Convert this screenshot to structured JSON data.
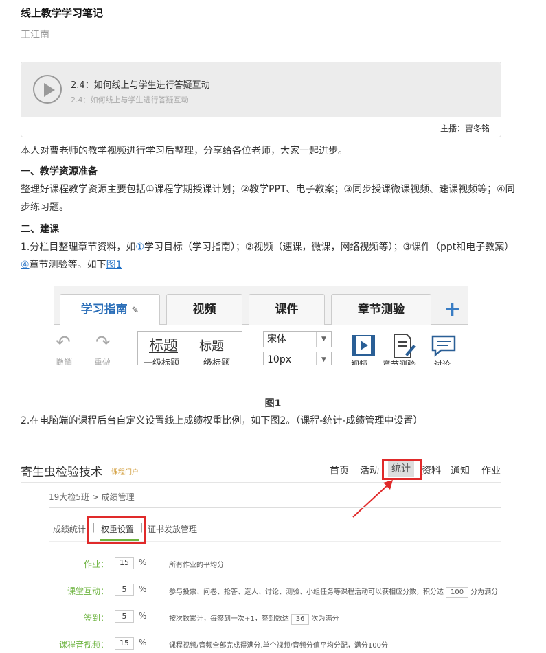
{
  "article": {
    "title": "线上教学学习笔记",
    "author": "王江南"
  },
  "audio": {
    "title": "2.4：如何线上与学生进行答疑互动",
    "subtitle": "2.4：如何线上与学生进行答疑互动",
    "host": "主播：曹冬铭"
  },
  "body": {
    "intro": "本人对曹老师的教学视频进行学习后整理，分享给各位老师，大家一起进步。",
    "h1": "一、教学资源准备",
    "p1": "整理好课程教学资源主要包括①课程学期授课计划；②教学PPT、电子教案；③同步授课微课视频、速课视频等；④同步练习题。",
    "h2": "二、建课",
    "p2_a": "1.分栏目整理章节资料，如",
    "p2_link1": "①",
    "p2_b": "学习目标（学习指南）；②视频（速课，微课，网络视频等）；③课件（ppt和电子教案）",
    "p2_link2": "④",
    "p2_c": "章节测验等。如下",
    "p2_link3": "图1",
    "fig1_caption": "图1",
    "p3": "2.在电脑端的课程后台自定义设置线上成绩权重比例，如下图2。（课程-统计-成绩管理中设置）"
  },
  "fig1": {
    "tabs": [
      "学习指南",
      "视频",
      "课件",
      "章节测验"
    ],
    "plus": "+",
    "undo_label": "撤销",
    "redo_label": "重做",
    "style_title_big": "标题",
    "style_title_med": "标题",
    "style_sub1": "一级标题",
    "style_sub2": "二级标题",
    "font_select": "宋体",
    "size_select": "10px",
    "insert_video": "视频",
    "insert_quiz": "章节测验",
    "insert_discuss": "讨论"
  },
  "fig2": {
    "course_name": "寄生虫检验技术",
    "course_sub": "课程门户",
    "nav": [
      "首页",
      "活动",
      "统计",
      "资料",
      "通知",
      "作业"
    ],
    "breadcrumb": "19大检5班 > 成绩管理",
    "subtabs": [
      "成绩统计",
      "权重设置",
      "证书发放管理"
    ],
    "rows": [
      {
        "label": "作业：",
        "value": "15",
        "unit": "%",
        "desc": "所有作业的平均分"
      },
      {
        "label": "课堂互动：",
        "value": "5",
        "unit": "%",
        "desc": "参与投票、问卷、抢答、选人、讨论、测验、小组任务等课程活动可以获相应分数，积分达",
        "extra_value": "100",
        "extra_text": "分为满分"
      },
      {
        "label": "签到：",
        "value": "5",
        "unit": "%",
        "desc": "按次数累计，每签到一次+1，签到数达",
        "extra_value": "36",
        "extra_text": "次为满分"
      },
      {
        "label": "课程音视频：",
        "value": "15",
        "unit": "%",
        "desc": "课程视频/音频全部完成得满分,单个视频/音频分值平均分配，满分100分"
      }
    ]
  },
  "colors": {
    "link": "#1f6fc5",
    "accent_green": "#6cb33e",
    "highlight_red": "#e02a2a",
    "tab_blue": "#2a6eb8"
  }
}
